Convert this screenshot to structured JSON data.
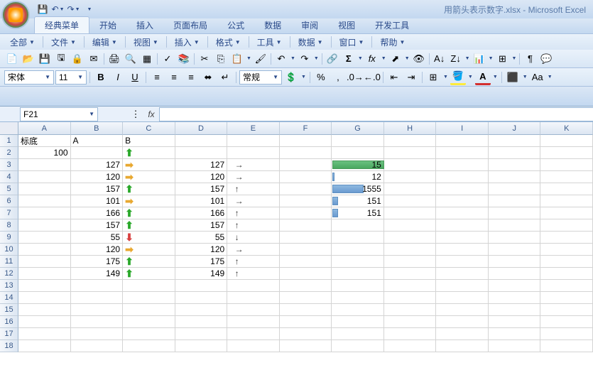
{
  "title": "用箭头表示数字.xlsx - Microsoft Excel",
  "tabs": {
    "classic": "经典菜单",
    "home": "开始",
    "insert": "插入",
    "layout": "页面布局",
    "formula": "公式",
    "data": "数据",
    "review": "审阅",
    "view": "视图",
    "dev": "开发工具"
  },
  "menus": {
    "all": "全部",
    "file": "文件",
    "edit": "编辑",
    "view": "视图",
    "insert": "插入",
    "format": "格式",
    "tools": "工具",
    "data": "数据",
    "window": "窗口",
    "help": "帮助"
  },
  "font": {
    "name": "宋体",
    "size": "11"
  },
  "numfmt": "常规",
  "namebox": "F21",
  "fx": "fx",
  "colw": {
    "A": 78,
    "B": 78,
    "C": 78,
    "D": 78,
    "E": 78,
    "F": 78,
    "G": 78,
    "H": 78,
    "I": 78,
    "J": 78,
    "K": 78
  },
  "cols": [
    "A",
    "B",
    "C",
    "D",
    "E",
    "F",
    "G",
    "H",
    "I",
    "J",
    "K"
  ],
  "rows": 18,
  "cells": {
    "A1": {
      "v": "标底"
    },
    "B1": {
      "v": "A",
      "align": "l"
    },
    "C1": {
      "v": "B",
      "align": "l"
    },
    "A2": {
      "v": "100",
      "align": "r"
    },
    "C2": {
      "arrow": "up-g"
    },
    "B3": {
      "v": "127",
      "align": "r"
    },
    "C3": {
      "arrow": "rt-y"
    },
    "D3": {
      "v": "127",
      "align": "r",
      "karrow": "→"
    },
    "G3": {
      "v": "15",
      "align": "r",
      "bar": 100,
      "barcolor": "green"
    },
    "B4": {
      "v": "120",
      "align": "r"
    },
    "C4": {
      "arrow": "rt-y"
    },
    "D4": {
      "v": "120",
      "align": "r",
      "karrow": "→"
    },
    "G4": {
      "v": "12",
      "align": "r",
      "bar": 4
    },
    "B5": {
      "v": "157",
      "align": "r"
    },
    "C5": {
      "arrow": "up-g"
    },
    "D5": {
      "v": "157",
      "align": "r",
      "karrow": "↑"
    },
    "G5": {
      "v": "1555",
      "align": "r",
      "bar": 60
    },
    "B6": {
      "v": "101",
      "align": "r"
    },
    "C6": {
      "arrow": "rt-y"
    },
    "D6": {
      "v": "101",
      "align": "r",
      "karrow": "→"
    },
    "G6": {
      "v": "151",
      "align": "r",
      "bar": 10
    },
    "B7": {
      "v": "166",
      "align": "r"
    },
    "C7": {
      "arrow": "up-g"
    },
    "D7": {
      "v": "166",
      "align": "r",
      "karrow": "↑"
    },
    "G7": {
      "v": "151",
      "align": "r",
      "bar": 10
    },
    "B8": {
      "v": "157",
      "align": "r"
    },
    "C8": {
      "arrow": "up-g"
    },
    "D8": {
      "v": "157",
      "align": "r",
      "karrow": "↑"
    },
    "B9": {
      "v": "55",
      "align": "r"
    },
    "C9": {
      "arrow": "dn-r"
    },
    "D9": {
      "v": "55",
      "align": "r",
      "karrow": "↓"
    },
    "B10": {
      "v": "120",
      "align": "r"
    },
    "C10": {
      "arrow": "rt-y"
    },
    "D10": {
      "v": "120",
      "align": "r",
      "karrow": "→"
    },
    "B11": {
      "v": "175",
      "align": "r"
    },
    "C11": {
      "arrow": "up-g"
    },
    "D11": {
      "v": "175",
      "align": "r",
      "karrow": "↑"
    },
    "B12": {
      "v": "149",
      "align": "r"
    },
    "C12": {
      "arrow": "up-g"
    },
    "D12": {
      "v": "149",
      "align": "r",
      "karrow": "↑"
    }
  }
}
